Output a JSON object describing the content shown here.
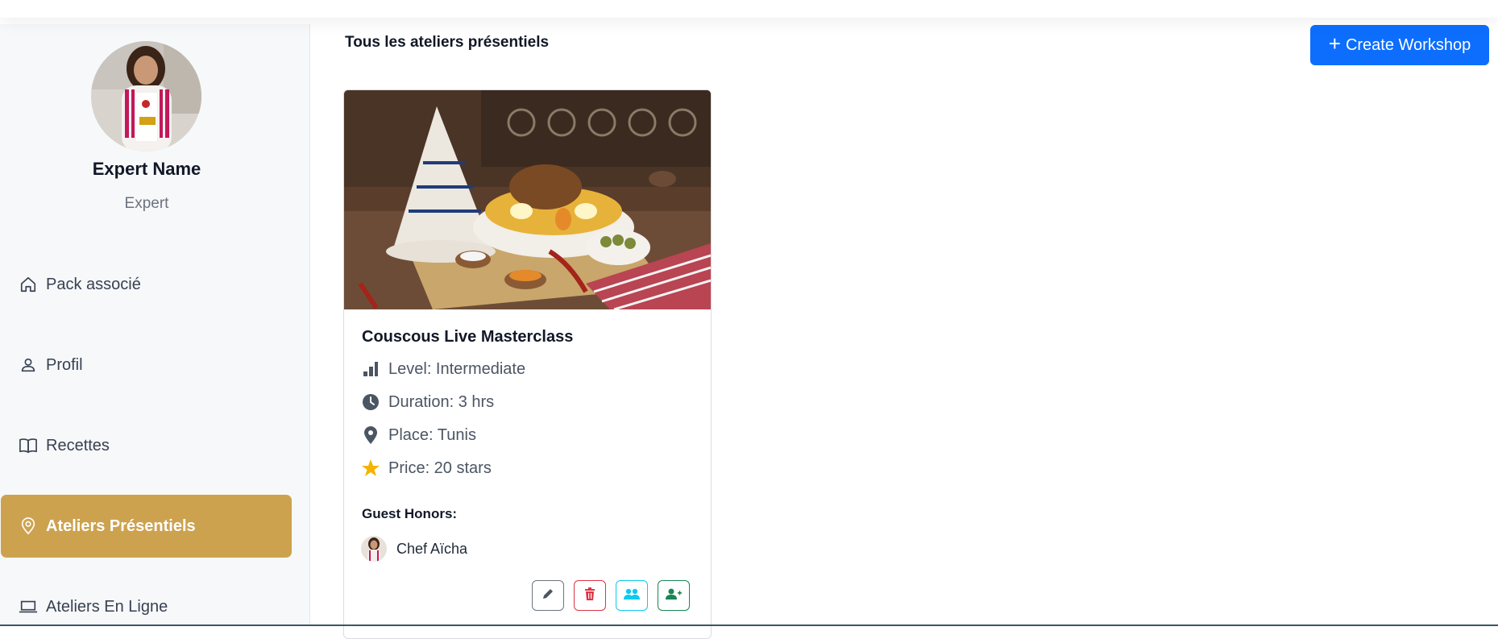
{
  "sidebar": {
    "expert_name": "Expert Name",
    "expert_role": "Expert",
    "items": [
      {
        "label": "Pack associé",
        "icon": "home-icon",
        "active": false
      },
      {
        "label": "Profil",
        "icon": "user-icon",
        "active": false
      },
      {
        "label": "Recettes",
        "icon": "book-icon",
        "active": false
      },
      {
        "label": "Ateliers Présentiels",
        "icon": "map-pin-icon",
        "active": true
      },
      {
        "label": "Ateliers En Ligne",
        "icon": "laptop-icon",
        "active": false
      }
    ]
  },
  "main": {
    "title": "Tous les ateliers présentiels",
    "create_button": {
      "plus": "+",
      "label": "Create Workshop"
    }
  },
  "workshop": {
    "title": "Couscous Live Masterclass",
    "level": "Level: Intermediate",
    "duration": "Duration: 3 hrs",
    "place": "Place: Tunis",
    "price": "Price: 20 stars",
    "guest_label": "Guest Honors:",
    "guest_name": "Chef Aïcha"
  },
  "colors": {
    "accent": "#cda24f",
    "primary": "#0d6efd",
    "edit": "#6c757d",
    "delete": "#dc3545",
    "participants": "#0dcaf0",
    "add_guest": "#198754",
    "star": "#f5b301"
  },
  "actions": [
    "pencil-icon",
    "trash-icon",
    "users-icon",
    "user-plus-icon"
  ]
}
